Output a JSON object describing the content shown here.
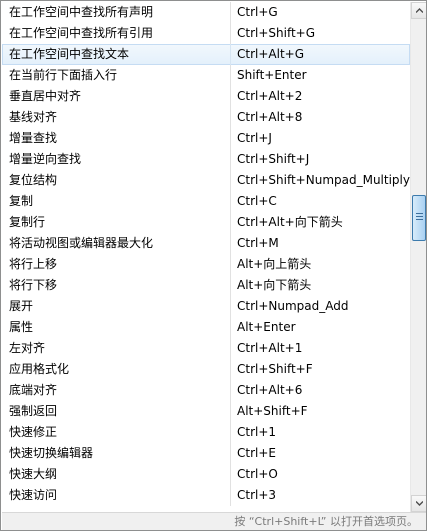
{
  "shortcuts": [
    {
      "command": "在工作空间中查找所有声明",
      "key": "Ctrl+G"
    },
    {
      "command": "在工作空间中查找所有引用",
      "key": "Ctrl+Shift+G"
    },
    {
      "command": "在工作空间中查找文本",
      "key": "Ctrl+Alt+G",
      "selected": true
    },
    {
      "command": "在当前行下面插入行",
      "key": "Shift+Enter"
    },
    {
      "command": "垂直居中对齐",
      "key": "Ctrl+Alt+2"
    },
    {
      "command": "基线对齐",
      "key": "Ctrl+Alt+8"
    },
    {
      "command": "增量查找",
      "key": "Ctrl+J"
    },
    {
      "command": "增量逆向查找",
      "key": "Ctrl+Shift+J"
    },
    {
      "command": "复位结构",
      "key": "Ctrl+Shift+Numpad_Multiply"
    },
    {
      "command": "复制",
      "key": "Ctrl+C"
    },
    {
      "command": "复制行",
      "key": "Ctrl+Alt+向下箭头"
    },
    {
      "command": "将活动视图或编辑器最大化",
      "key": "Ctrl+M"
    },
    {
      "command": "将行上移",
      "key": "Alt+向上箭头"
    },
    {
      "command": "将行下移",
      "key": "Alt+向下箭头"
    },
    {
      "command": "展开",
      "key": "Ctrl+Numpad_Add"
    },
    {
      "command": "属性",
      "key": "Alt+Enter"
    },
    {
      "command": "左对齐",
      "key": "Ctrl+Alt+1"
    },
    {
      "command": "应用格式化",
      "key": "Ctrl+Shift+F"
    },
    {
      "command": "底端对齐",
      "key": "Ctrl+Alt+6"
    },
    {
      "command": "强制返回",
      "key": "Alt+Shift+F"
    },
    {
      "command": "快速修正",
      "key": "Ctrl+1"
    },
    {
      "command": "快速切换编辑器",
      "key": "Ctrl+E"
    },
    {
      "command": "快速大纲",
      "key": "Ctrl+O"
    },
    {
      "command": "快速访问",
      "key": "Ctrl+3"
    }
  ],
  "status_text": "按 “Ctrl+Shift+L” 以打开首选项页。",
  "icons": {
    "scroll_up": "chevron-up-icon",
    "scroll_down": "chevron-down-icon",
    "thumb_grip": "grip-lines-icon"
  },
  "colors": {
    "selected_row": "#e3f0fb",
    "scroll_thumb": "#a9d1f2",
    "status_text": "#7a7a7a"
  }
}
